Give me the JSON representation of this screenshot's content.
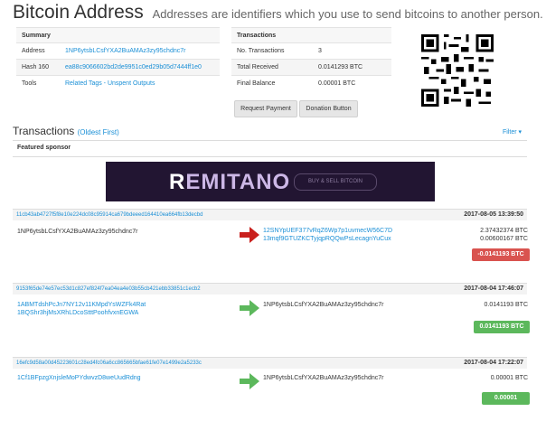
{
  "header": {
    "title": "Bitcoin Address",
    "subtitle": "Addresses are identifiers which you use to send bitcoins to another person."
  },
  "summary": {
    "heading": "Summary",
    "rows": [
      {
        "label": "Address",
        "value": "1NP6ytsbLCsfYXA2BuAMAz3zy95chdnc7r"
      },
      {
        "label": "Hash 160",
        "value": "ea88c9066602bd2de9951c0ed29b05d7444ff1e0"
      },
      {
        "label": "Tools",
        "value": "Related Tags - Unspent Outputs"
      }
    ]
  },
  "transactions_summary": {
    "heading": "Transactions",
    "rows": [
      {
        "label": "No. Transactions",
        "value": "3"
      },
      {
        "label": "Total Received",
        "value": "0.0141293 BTC"
      },
      {
        "label": "Final Balance",
        "value": "0.00001 BTC"
      }
    ]
  },
  "buttons": {
    "request_payment": "Request Payment",
    "donation_button": "Donation Button"
  },
  "tx_section": {
    "title": "Transactions",
    "order": "(Oldest First)",
    "filter": "Filter ▾",
    "sponsor": "Featured sponsor"
  },
  "banner": {
    "brand_first": "R",
    "brand_rest": "EMITANO",
    "button": "BUY & SELL BITCOIN"
  },
  "txs": [
    {
      "hash": "11cb43ab4727f5f8e10e224dc08c95914ca679bdeeed164410ea664fb13decbd",
      "time": "2017-08-05 13:39:50",
      "from": [
        "1NP6ytsbLCsfYXA2BuAMAz3zy95chdnc7r"
      ],
      "to": [
        "12SNYpUEF377vRqZ6Wp7p1uvmecW56C7D",
        "13mqf9GTUZKCTyjqpRQQwPsLecagnYuCux"
      ],
      "amounts": [
        "2.37432374 BTC",
        "0.00600167 BTC"
      ],
      "result": "-0.0141193 BTC",
      "arrow_color": "#c9201d",
      "result_color": "#d9534f"
    },
    {
      "hash": "9153f65de74e57ec53d1c827ef824f7ea04ea4e03b55cb421ebb33851c1ecb2",
      "time": "2017-08-04 17:46:07",
      "from": [
        "1ABMTdshPcJn7NY12v11KMpdYsWZFk4Rat",
        "1BQShr3hjMsXRhLDcoStttPoohfvxnEGWA"
      ],
      "to": [
        "1NP6ytsbLCsfYXA2BuAMAz3zy95chdnc7r"
      ],
      "amounts": [
        "0.0141193 BTC"
      ],
      "result": "0.0141193 BTC",
      "arrow_color": "#5cb85c",
      "result_color": "#5cb85c"
    },
    {
      "hash": "16efc9d58a00d45223601c28ed4fc06a6cc865665bfae61fe07e1499e2a5233c",
      "time": "2017-08-04 17:22:07",
      "from": [
        "1Cf1BFpzgXnjsleMoPYdwvzD8weUudRdng"
      ],
      "to": [
        "1NP6ytsbLCsfYXA2BuAMAz3zy95chdnc7r"
      ],
      "amounts": [
        "0.00001 BTC"
      ],
      "result": "0.00001 BTC",
      "arrow_color": "#5cb85c",
      "result_color": "#5cb85c"
    }
  ]
}
